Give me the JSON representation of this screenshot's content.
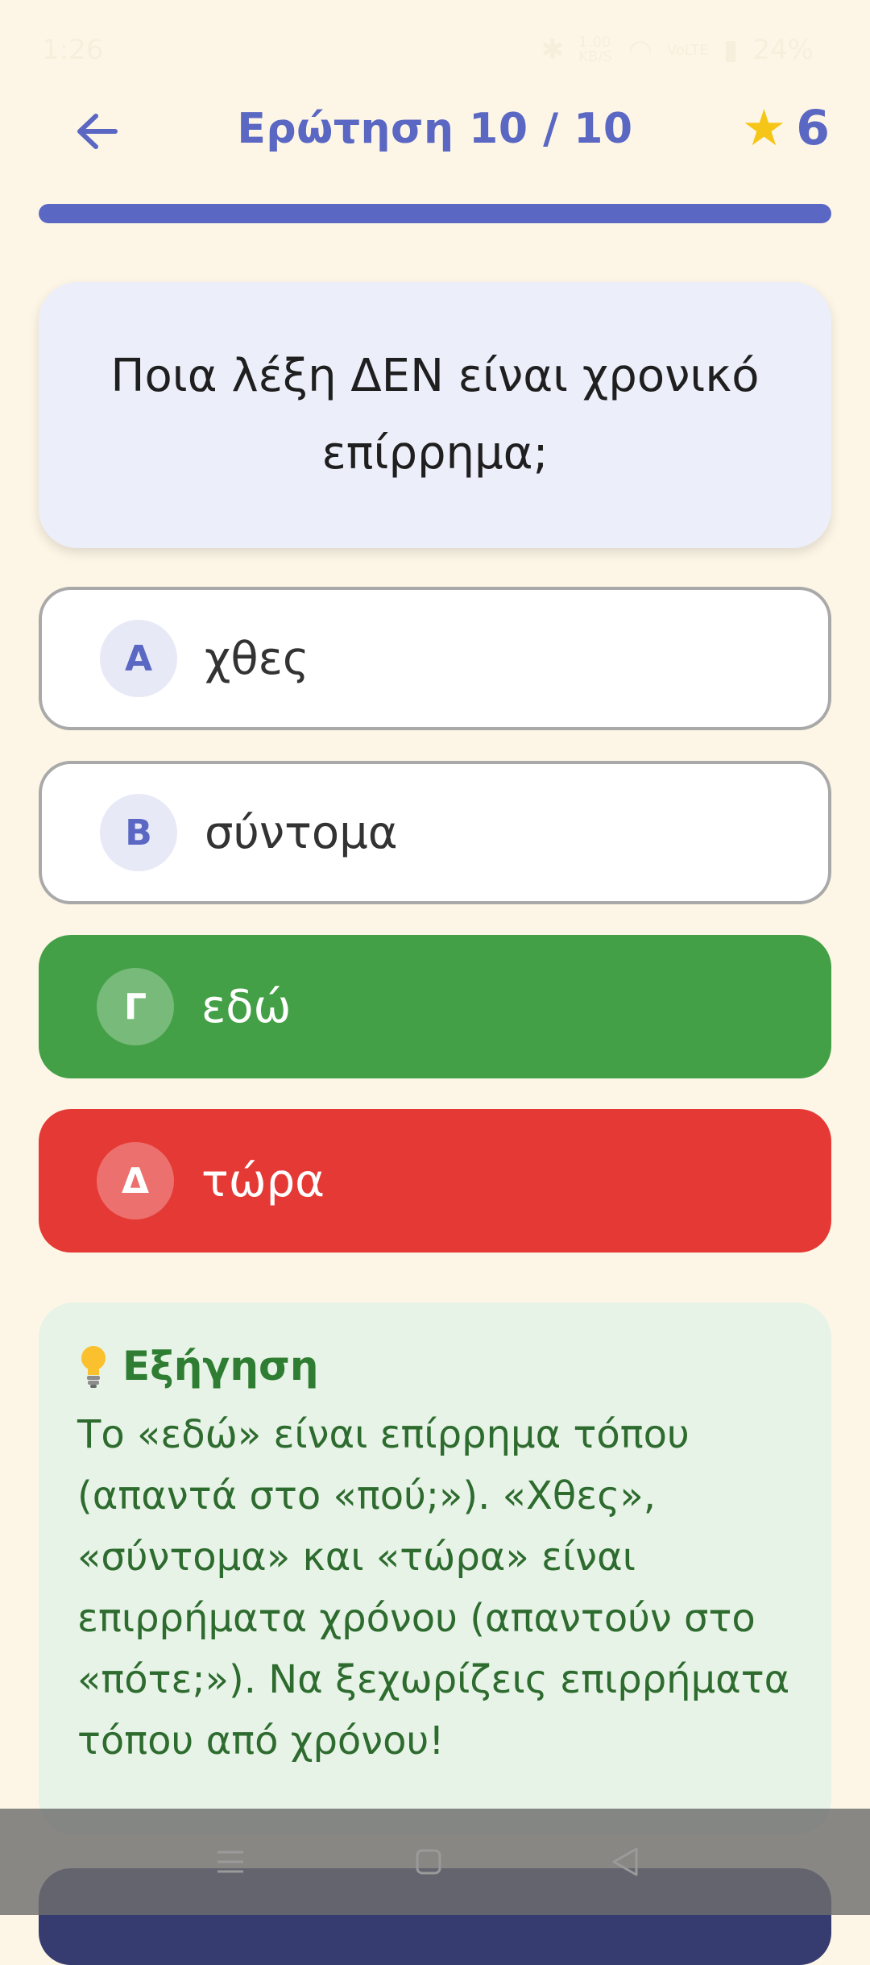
{
  "status": {
    "time": "1:26",
    "speed": "1.00 KB/S",
    "network": "VoLTE",
    "battery": "24%"
  },
  "header": {
    "title": "Ερώτηση 10 / 10",
    "score": "6"
  },
  "progress": {
    "fraction": 1.0
  },
  "question": {
    "text": "Ποια λέξη ΔΕΝ είναι χρονικό επίρρημα;"
  },
  "answers": [
    {
      "letter": "Α",
      "label": "χθες",
      "state": "neutral"
    },
    {
      "letter": "Β",
      "label": "σύντομα",
      "state": "neutral"
    },
    {
      "letter": "Γ",
      "label": "εδώ",
      "state": "correct"
    },
    {
      "letter": "Δ",
      "label": "τώρα",
      "state": "wrong"
    }
  ],
  "explanation": {
    "title": "Εξήγηση",
    "text": "Το «εδώ» είναι επίρρημα τόπου (απαντά στο «πού;»). «Χθες», «σύντομα» και «τώρα» είναι επιρρήματα χρόνου (απαντούν στο «πότε;»). Να ξεχωρίζεις επιρρήματα τόπου από χρόνου!"
  },
  "colors": {
    "accent": "#5a67c3",
    "correct": "#43a047",
    "wrong": "#e53935",
    "background": "#fdf6e6"
  },
  "icons": {
    "back": "arrow-left-icon",
    "score": "star-icon",
    "explanation": "lightbulb-icon"
  }
}
